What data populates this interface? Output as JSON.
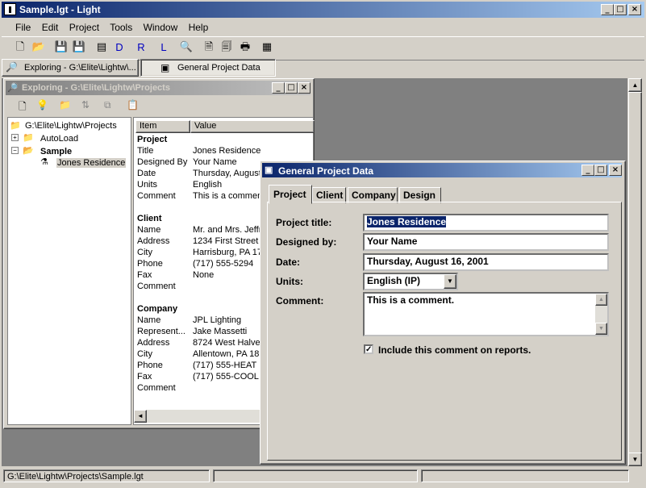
{
  "app": {
    "title": "Sample.lgt - Light"
  },
  "menu": [
    "File",
    "Edit",
    "Project",
    "Tools",
    "Window",
    "Help"
  ],
  "toolbar": {
    "d": "D",
    "r": "R",
    "l": "L"
  },
  "tabs": [
    "Exploring - G:\\Elite\\Lightw\\...",
    "General Project Data"
  ],
  "explorer": {
    "title": "Exploring - G:\\Elite\\Lightw\\Projects",
    "tree": {
      "root": "G:\\Elite\\Lightw\\Projects",
      "autoload": "AutoLoad",
      "sample": "Sample",
      "residence": "Jones Residence"
    },
    "columns": [
      "Item",
      "Value"
    ],
    "sections": {
      "project": "Project",
      "client": "Client",
      "company": "Company"
    },
    "project_rows": [
      [
        "Title",
        "Jones Residence"
      ],
      [
        "Designed By",
        "Your Name"
      ],
      [
        "Date",
        "Thursday, August"
      ],
      [
        "Units",
        "English"
      ],
      [
        "Comment",
        "This is a commen"
      ]
    ],
    "client_rows": [
      [
        "Name",
        "Mr. and Mrs. Jeffr"
      ],
      [
        "Address",
        "1234 First Street N"
      ],
      [
        "City",
        "Harrisburg, PA  17"
      ],
      [
        "Phone",
        "(717) 555-5294"
      ],
      [
        "Fax",
        "None"
      ],
      [
        "Comment",
        ""
      ]
    ],
    "company_rows": [
      [
        "Name",
        "JPL Lighting"
      ],
      [
        "Represent...",
        "Jake Massetti"
      ],
      [
        "Address",
        "8724 West Halve"
      ],
      [
        "City",
        "Allentown, PA  18"
      ],
      [
        "Phone",
        "(717) 555-HEAT"
      ],
      [
        "Fax",
        "(717) 555-COOL"
      ],
      [
        "Comment",
        ""
      ]
    ]
  },
  "dialog": {
    "title": "General Project Data",
    "tabs": [
      "Project",
      "Client",
      "Company",
      "Design"
    ],
    "labels": {
      "title": "Project title:",
      "designed": "Designed by:",
      "date": "Date:",
      "units": "Units:",
      "comment": "Comment:"
    },
    "values": {
      "title": "Jones Residence",
      "designed": "Your Name",
      "date": "Thursday, August 16, 2001",
      "units": "English (IP)",
      "comment": "This is a comment."
    },
    "checkbox": {
      "label": "Include this comment on reports.",
      "checked": true
    }
  },
  "status": {
    "path": "G:\\Elite\\Lightw\\Projects\\Sample.lgt"
  }
}
